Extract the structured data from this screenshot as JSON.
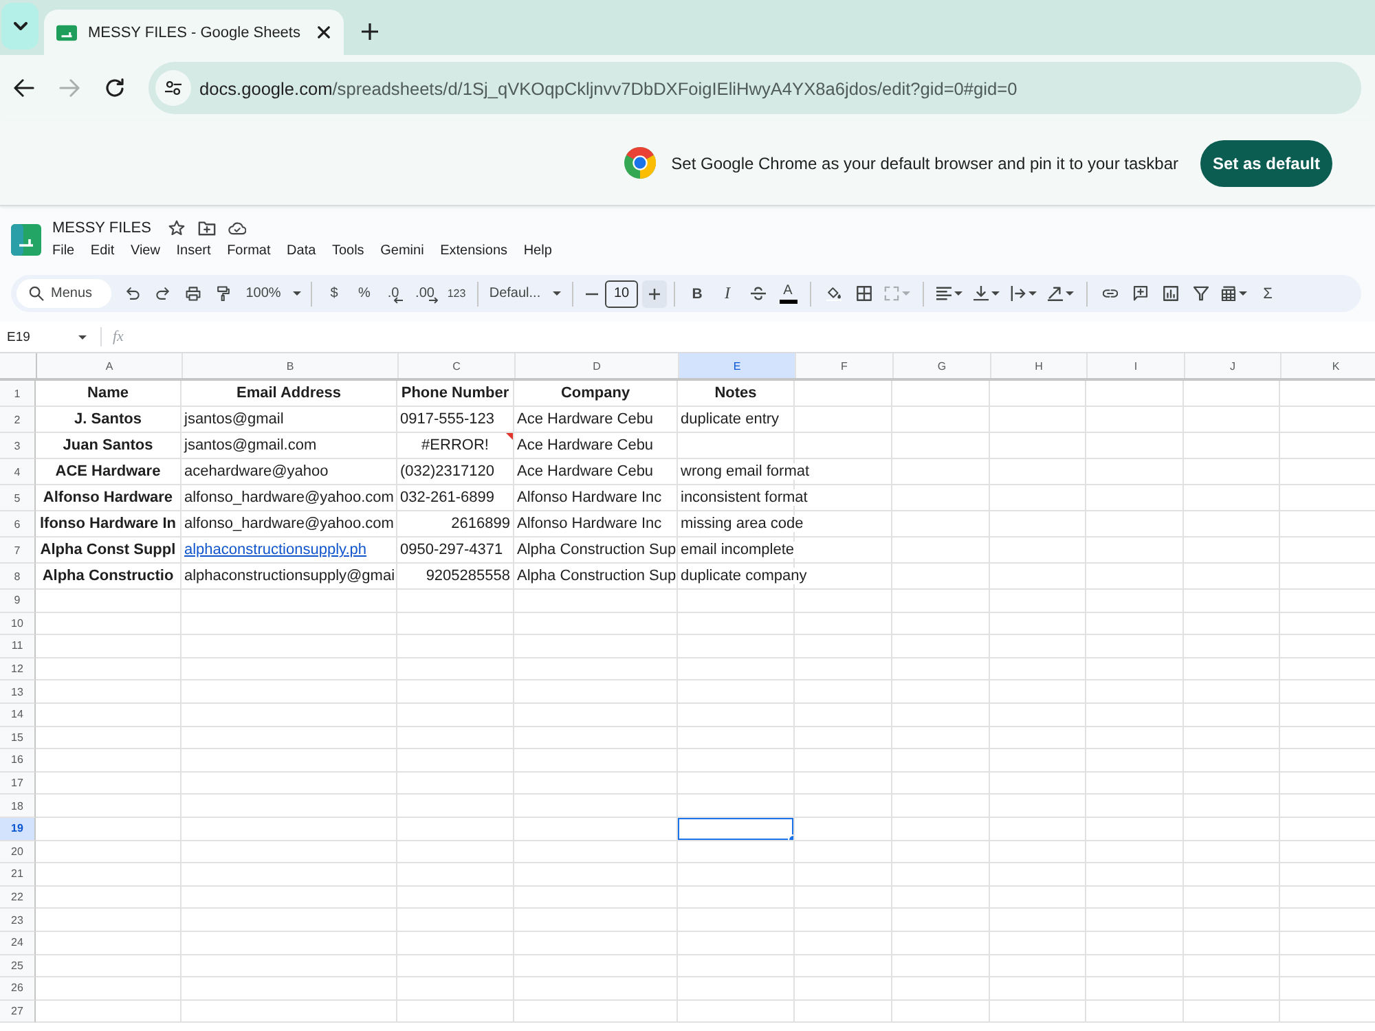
{
  "browser": {
    "tab": {
      "title": "MESSY FILES - Google Sheets"
    },
    "forward_disabled": true,
    "url": {
      "host": "docs.google.com",
      "path": "/spreadsheets/d/1Sj_qVKOqpCkljnvv7DbDXFoigIEliHwyA4YX8a6jdos/edit?gid=0#gid=0"
    }
  },
  "infobar": {
    "message": "Set Google Chrome as your default browser and pin it to your taskbar",
    "button": "Set as default"
  },
  "document": {
    "title": "MESSY FILES",
    "menus": [
      "File",
      "Edit",
      "View",
      "Insert",
      "Format",
      "Data",
      "Tools",
      "Gemini",
      "Extensions",
      "Help"
    ]
  },
  "toolbar": {
    "search": {
      "placeholder": "Menus"
    },
    "zoom": "100%",
    "currency": "$",
    "percent": "%",
    "decrease_decimals": ".0",
    "increase_decimals": ".00",
    "number_format": "123",
    "font": "Defaul...",
    "font_size": "10",
    "bold": "B",
    "italic": "I",
    "text_color": "A",
    "merge": {
      "disabled": true
    },
    "functions": "Σ"
  },
  "formula_bar": {
    "name_box": "E19",
    "fx": "fx"
  },
  "sheet": {
    "columns": [
      {
        "label": "A",
        "selected": false
      },
      {
        "label": "B",
        "selected": false
      },
      {
        "label": "C",
        "selected": false
      },
      {
        "label": "D",
        "selected": false
      },
      {
        "label": "E",
        "selected": true
      },
      {
        "label": "F",
        "selected": false
      },
      {
        "label": "G",
        "selected": false
      },
      {
        "label": "H",
        "selected": false
      },
      {
        "label": "I",
        "selected": false
      },
      {
        "label": "J",
        "selected": false
      },
      {
        "label": "K",
        "selected": false
      }
    ],
    "rows": [
      {
        "number": "1",
        "selected": false,
        "cells": [
          {
            "text": "Name",
            "kind": "heading"
          },
          {
            "text": "Email Address",
            "kind": "heading"
          },
          {
            "text": "Phone Number",
            "kind": "heading"
          },
          {
            "text": "Company",
            "kind": "heading"
          },
          {
            "text": "Notes",
            "kind": "heading"
          }
        ]
      },
      {
        "number": "2",
        "selected": false,
        "cells": [
          {
            "text": "J. Santos",
            "kind": "heading"
          },
          {
            "text": "jsantos@gmail",
            "kind": "text"
          },
          {
            "text": "0917-555-123",
            "kind": "text"
          },
          {
            "text": "Ace Hardware Cebu",
            "kind": "text"
          },
          {
            "text": "duplicate entry",
            "kind": "text"
          }
        ]
      },
      {
        "number": "3",
        "selected": false,
        "cells": [
          {
            "text": "Juan Santos",
            "kind": "heading"
          },
          {
            "text": "jsantos@gmail.com",
            "kind": "text"
          },
          {
            "text": "#ERROR!",
            "kind": "error"
          },
          {
            "text": "Ace Hardware Cebu",
            "kind": "text"
          },
          null
        ]
      },
      {
        "number": "4",
        "selected": false,
        "cells": [
          {
            "text": "ACE Hardware",
            "kind": "heading"
          },
          {
            "text": "acehardware@yahoo",
            "kind": "text"
          },
          {
            "text": "(032)2317120",
            "kind": "text"
          },
          {
            "text": "Ace Hardware Cebu",
            "kind": "text"
          },
          {
            "text": "wrong email format",
            "kind": "text"
          }
        ]
      },
      {
        "number": "5",
        "selected": false,
        "cells": [
          {
            "text": "Alfonso Hardware",
            "kind": "heading"
          },
          {
            "text": "alfonso_hardware@yahoo.com",
            "kind": "text"
          },
          {
            "text": "032-261-6899",
            "kind": "text"
          },
          {
            "text": "Alfonso Hardware Inc",
            "kind": "text"
          },
          {
            "text": "inconsistent format",
            "kind": "text"
          }
        ]
      },
      {
        "number": "6",
        "selected": false,
        "cells": [
          {
            "text": "lfonso Hardware In",
            "kind": "heading"
          },
          {
            "text": "alfonso_hardware@yahoo.com",
            "kind": "text"
          },
          {
            "text": "2616899",
            "kind": "number"
          },
          {
            "text": "Alfonso Hardware Inc",
            "kind": "text"
          },
          {
            "text": "missing area code",
            "kind": "text"
          }
        ]
      },
      {
        "number": "7",
        "selected": false,
        "cells": [
          {
            "text": "Alpha Const Suppl",
            "kind": "heading"
          },
          {
            "text": "alphaconstructionsupply.ph",
            "kind": "link"
          },
          {
            "text": "0950-297-4371",
            "kind": "text"
          },
          {
            "text": "Alpha Construction Sup",
            "kind": "text"
          },
          {
            "text": "email incomplete",
            "kind": "text"
          }
        ]
      },
      {
        "number": "8",
        "selected": false,
        "cells": [
          {
            "text": "Alpha Constructio",
            "kind": "heading"
          },
          {
            "text": "alphaconstructionsupply@gmai",
            "kind": "text"
          },
          {
            "text": "9205285558",
            "kind": "number"
          },
          {
            "text": "Alpha Construction Sup",
            "kind": "text"
          },
          {
            "text": "duplicate company",
            "kind": "text"
          }
        ]
      },
      {
        "number": "9",
        "selected": false
      },
      {
        "number": "10",
        "selected": false
      },
      {
        "number": "11",
        "selected": false
      },
      {
        "number": "12",
        "selected": false
      },
      {
        "number": "13",
        "selected": false
      },
      {
        "number": "14",
        "selected": false
      },
      {
        "number": "15",
        "selected": false
      },
      {
        "number": "16",
        "selected": false
      },
      {
        "number": "17",
        "selected": false
      },
      {
        "number": "18",
        "selected": false
      },
      {
        "number": "19",
        "selected": true
      },
      {
        "number": "20",
        "selected": false
      },
      {
        "number": "21",
        "selected": false
      },
      {
        "number": "22",
        "selected": false
      },
      {
        "number": "23",
        "selected": false
      },
      {
        "number": "24",
        "selected": false
      },
      {
        "number": "25",
        "selected": false
      },
      {
        "number": "26",
        "selected": false
      },
      {
        "number": "27",
        "selected": false
      }
    ]
  }
}
